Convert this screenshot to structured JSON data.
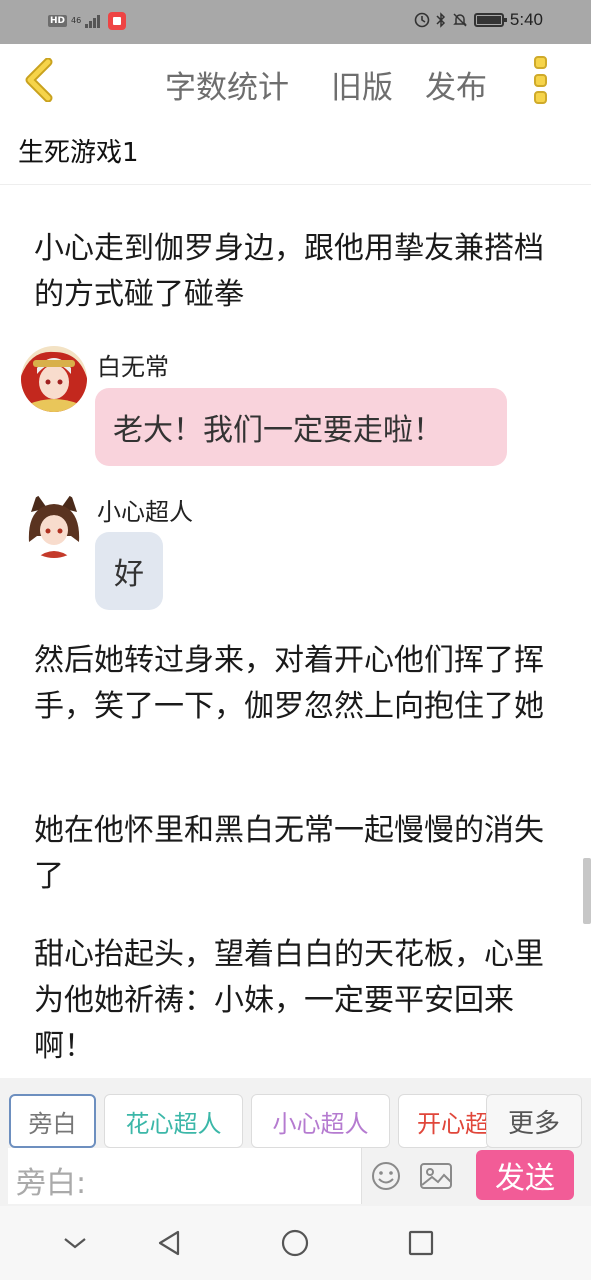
{
  "status_bar": {
    "hd_label": "HD",
    "network_label": "46",
    "time": "5:40",
    "icons": [
      "hd-icon",
      "signal-icon",
      "app-notification-icon",
      "do-not-disturb-icon",
      "bluetooth-icon",
      "mute-icon",
      "battery-icon"
    ]
  },
  "header": {
    "back_icon": "chevron-left-icon",
    "word_count": "字数统计",
    "old_version": "旧版",
    "publish": "发布",
    "more_icon": "vertical-dots-icon",
    "accent_color": "#f6d44a"
  },
  "document": {
    "title": "生死游戏1"
  },
  "messages": [
    {
      "type": "narration",
      "text": "小心走到伽罗身边，跟他用挚友兼搭档的方式碰了碰拳"
    },
    {
      "type": "dialogue",
      "speaker": "白无常",
      "text": "老大！我们一定要走啦！",
      "bubble_color": "#f9d3dc"
    },
    {
      "type": "dialogue",
      "speaker": "小心超人",
      "text": "好",
      "bubble_color": "#e1e7f0"
    },
    {
      "type": "narration",
      "text": "然后她转过身来，对着开心他们挥了挥手，笑了一下，伽罗忽然上向抱住了她"
    },
    {
      "type": "narration",
      "text": "她在他怀里和黑白无常一起慢慢的消失了"
    },
    {
      "type": "narration",
      "text": "甜心抬起头，望着白白的天花板，心里为他她祈祷：小妹，一定要平安回来啊！"
    }
  ],
  "roles": [
    {
      "label": "旁白",
      "color": "#777777",
      "active": true
    },
    {
      "label": "花心超人",
      "color": "#3bb7a8",
      "active": false
    },
    {
      "label": "小心超人",
      "color": "#b57bd0",
      "active": false
    },
    {
      "label": "开心超人",
      "color": "#e0463a",
      "active": false
    }
  ],
  "more_roles": "更多",
  "composer": {
    "prefix": "旁白:",
    "placeholder": "",
    "emoji_icon": "smiley-icon",
    "image_icon": "image-icon",
    "send": "发送",
    "send_color": "#f25c97"
  },
  "nav": {
    "icons": [
      "nav-collapse-icon",
      "nav-back-icon",
      "nav-home-icon",
      "nav-recents-icon"
    ]
  }
}
